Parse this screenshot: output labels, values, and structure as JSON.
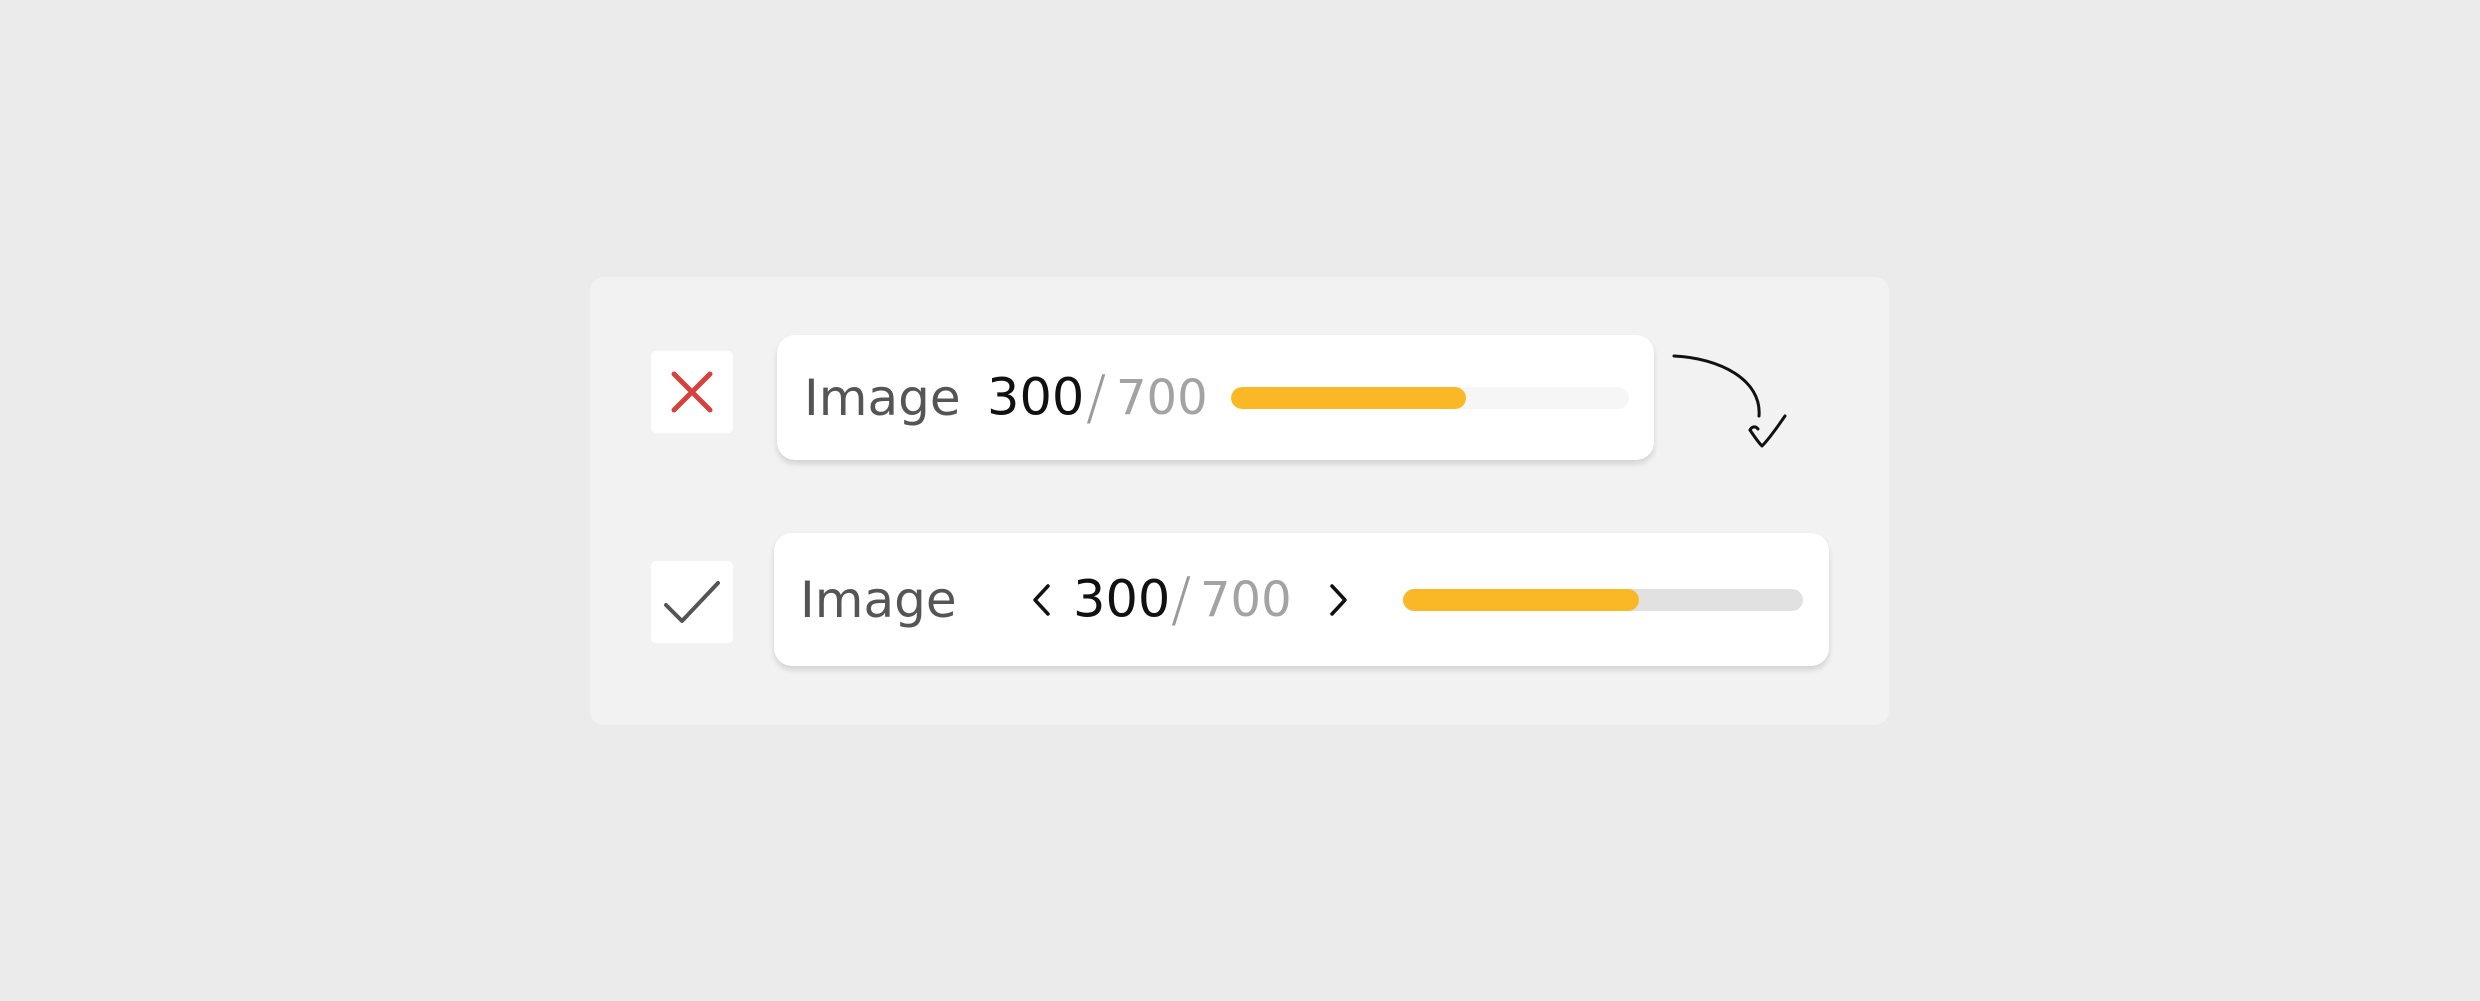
{
  "bad_example": {
    "status_icon": "close-icon",
    "status_color": "#d7413b",
    "label": "Image",
    "current": "300",
    "separator": "/",
    "total": "700",
    "progress": 0.59
  },
  "good_example": {
    "status_icon": "check-icon",
    "label": "Image",
    "prev_icon": "chevron-left-icon",
    "current": "300",
    "separator": "/",
    "total": "700",
    "next_icon": "chevron-right-icon",
    "progress": 0.59
  },
  "annotation": {
    "icon": "curved-arrow-icon"
  },
  "colors": {
    "progress_fill": "#fbb826",
    "background": "#ebebeb",
    "panel": "#f2f2f2"
  }
}
